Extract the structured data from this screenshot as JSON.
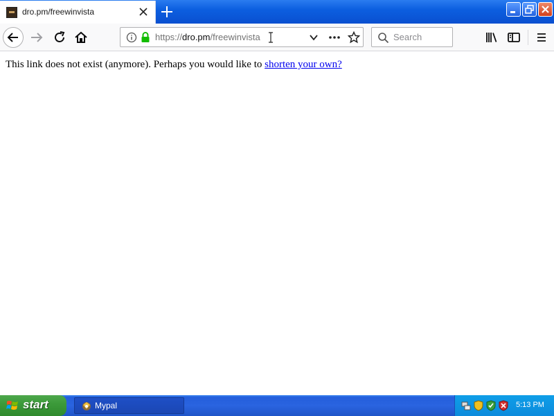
{
  "tab": {
    "title": "dro.pm/freewinvista",
    "favicon": "site-favicon"
  },
  "toolbar": {
    "url_scheme": "https://",
    "url_host": "dro.pm",
    "url_path": "/freewinvista",
    "search_placeholder": "Search"
  },
  "content": {
    "message": "This link does not exist (anymore). Perhaps you would like to ",
    "link_text": "shorten your own?"
  },
  "taskbar": {
    "start_label": "start",
    "task_label": "Mypal",
    "clock": "5:13 PM"
  },
  "colors": {
    "link": "#0000ee",
    "taskbar": "#245edb",
    "start": "#3c9a3a",
    "tray": "#0c8bdc"
  }
}
